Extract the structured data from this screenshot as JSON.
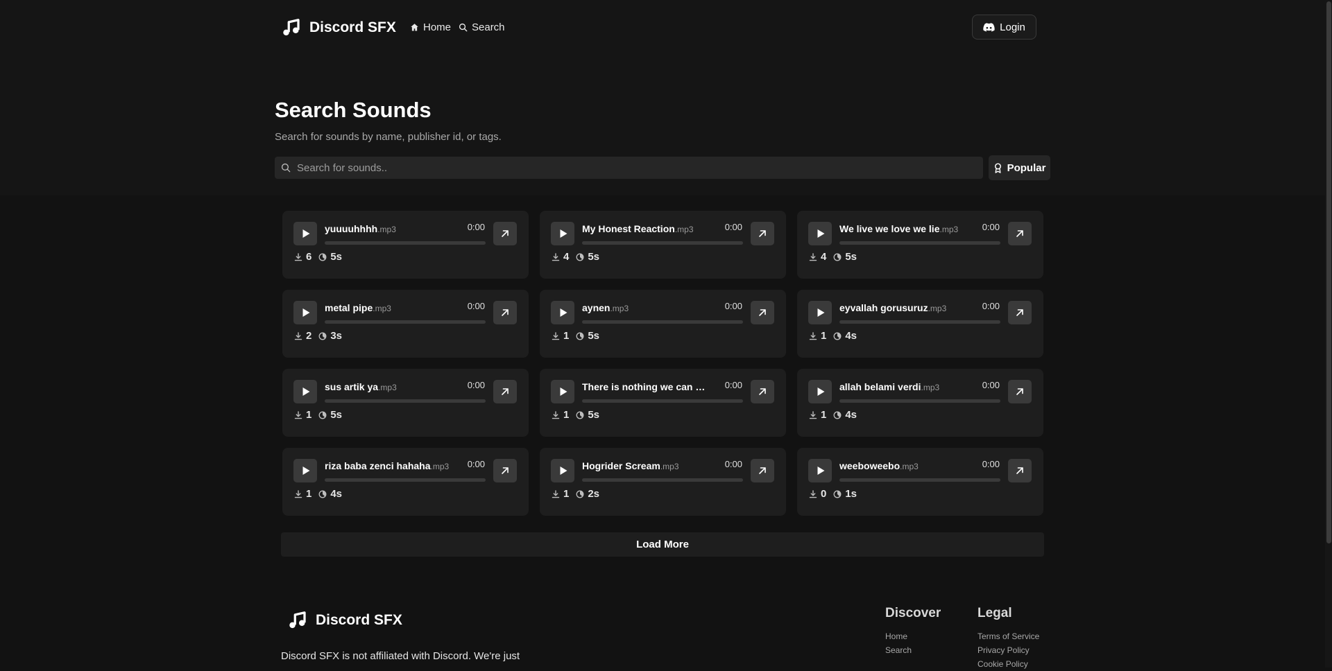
{
  "header": {
    "brand": "Discord SFX",
    "nav": [
      {
        "label": "Home",
        "icon": "home-icon"
      },
      {
        "label": "Search",
        "icon": "search-icon"
      }
    ],
    "login_label": "Login"
  },
  "main": {
    "title": "Search Sounds",
    "subtitle": "Search for sounds by name, publisher id, or tags.",
    "search_placeholder": "Search for sounds..",
    "search_value": "",
    "sort_label": "Popular",
    "load_more_label": "Load More"
  },
  "sounds": [
    {
      "name": "yuuuuhhhh",
      "ext": ".mp3",
      "duration": "0:00",
      "downloads": "6",
      "length": "5s"
    },
    {
      "name": "My Honest Reaction",
      "ext": ".mp3",
      "duration": "0:00",
      "downloads": "4",
      "length": "5s"
    },
    {
      "name": "We live we love we lie",
      "ext": ".mp3",
      "duration": "0:00",
      "downloads": "4",
      "length": "5s"
    },
    {
      "name": "metal pipe",
      "ext": ".mp3",
      "duration": "0:00",
      "downloads": "2",
      "length": "3s"
    },
    {
      "name": "aynen",
      "ext": ".mp3",
      "duration": "0:00",
      "downloads": "1",
      "length": "5s"
    },
    {
      "name": "eyvallah gorusuruz",
      "ext": ".mp3",
      "duration": "0:00",
      "downloads": "1",
      "length": "4s"
    },
    {
      "name": "sus artik ya",
      "ext": ".mp3",
      "duration": "0:00",
      "downloads": "1",
      "length": "5s"
    },
    {
      "name": "There is nothing we can do",
      "ext": ".mp3",
      "duration": "0:00",
      "downloads": "1",
      "length": "5s"
    },
    {
      "name": "allah belami verdi",
      "ext": ".mp3",
      "duration": "0:00",
      "downloads": "1",
      "length": "4s"
    },
    {
      "name": "riza baba zenci hahaha",
      "ext": ".mp3",
      "duration": "0:00",
      "downloads": "1",
      "length": "4s"
    },
    {
      "name": "Hogrider Scream",
      "ext": ".mp3",
      "duration": "0:00",
      "downloads": "1",
      "length": "2s"
    },
    {
      "name": "weeboweebo",
      "ext": ".mp3",
      "duration": "0:00",
      "downloads": "0",
      "length": "1s"
    }
  ],
  "footer": {
    "brand": "Discord SFX",
    "disclaimer": "Discord SFX is not affiliated with Discord. We're just",
    "discover": {
      "title": "Discover",
      "links": [
        "Home",
        "Search"
      ]
    },
    "legal": {
      "title": "Legal",
      "links": [
        "Terms of Service",
        "Privacy Policy",
        "Cookie Policy"
      ]
    }
  },
  "colors": {
    "background": "#121212",
    "card": "#1e1e1e",
    "button": "#3a3a3a",
    "text": "#ffffff",
    "muted": "#a9a9a9"
  }
}
